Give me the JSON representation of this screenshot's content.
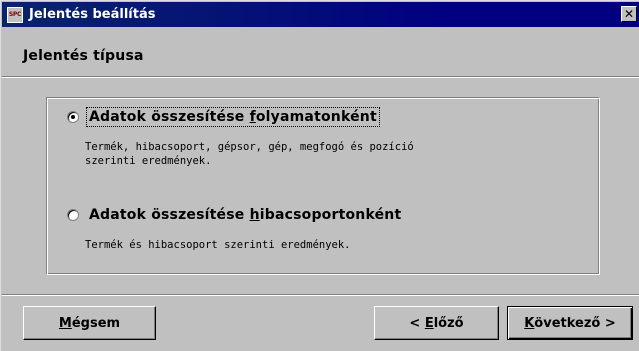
{
  "window": {
    "title": "Jelentés beállítás",
    "app_icon_text": "SPC",
    "close_glyph": "✕"
  },
  "header": {
    "section_title": "Jelentés típusa"
  },
  "options": [
    {
      "label_pre": "Adatok összesítése ",
      "label_u": "f",
      "label_post": "olyamatonként",
      "selected": true,
      "description": "Termék, hibacsoport, gépsor, gép, megfogó és pozíció\nszerinti eredmények."
    },
    {
      "label_pre": "Adatok összesítése ",
      "label_u": "h",
      "label_post": "ibacsoportonként",
      "selected": false,
      "description": "Termék és hibacsoport szerinti eredmények."
    }
  ],
  "buttons": {
    "cancel_u": "M",
    "cancel_rest": "égsem",
    "prev_prefix": "< ",
    "prev_u": "E",
    "prev_rest": "lőző",
    "next_u": "K",
    "next_rest": "övetkező >"
  }
}
